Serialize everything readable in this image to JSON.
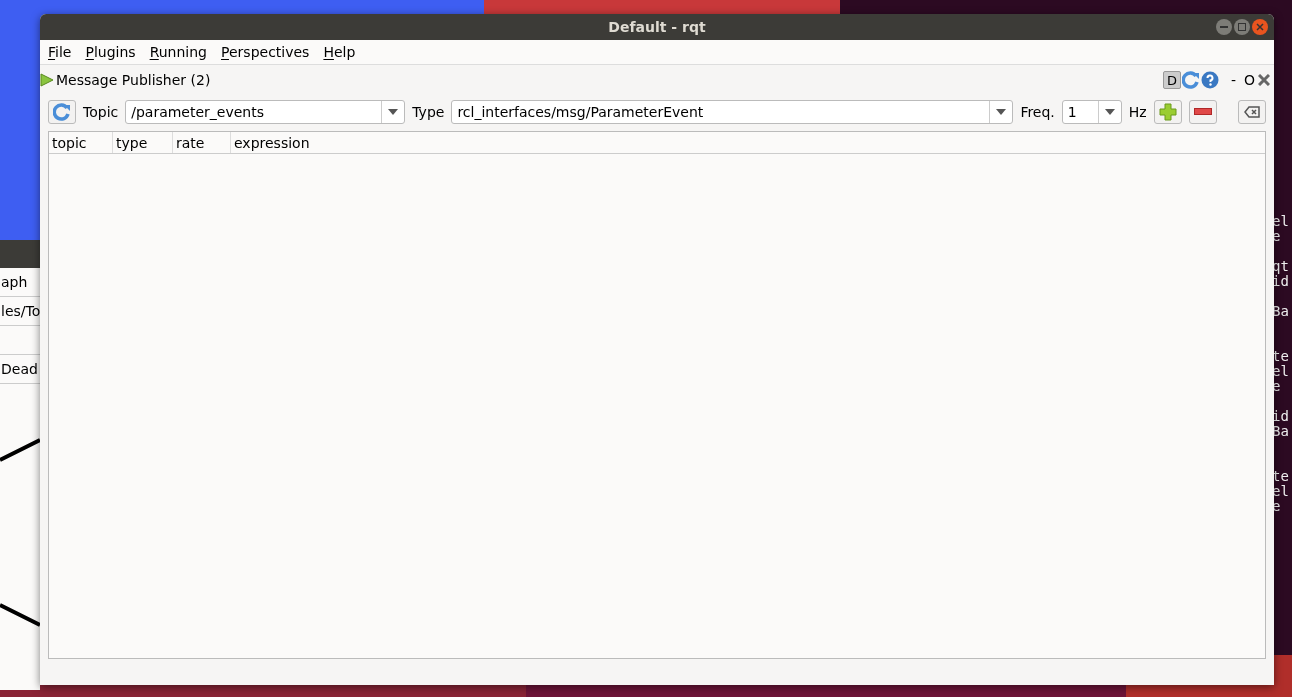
{
  "background_window": {
    "tab": "aph",
    "path": "les/To",
    "option": "Dead"
  },
  "terminal": {
    "lines": [
      "el",
      "e",
      "qt",
      "id",
      "Ba",
      "te",
      "el",
      "e",
      "id",
      "Ba",
      "te",
      "el",
      "e"
    ]
  },
  "window": {
    "title": "Default - rqt"
  },
  "menu": [
    "File",
    "Plugins",
    "Running",
    "Perspectives",
    "Help"
  ],
  "plugin": {
    "title": "Message Publisher (2)",
    "badge": "D",
    "minimize": "-",
    "float": "O"
  },
  "toolbar": {
    "topic_label": "Topic",
    "topic": "/parameter_events",
    "type_label": "Type",
    "type": "rcl_interfaces/msg/ParameterEvent",
    "freq_label": "Freq.",
    "freq": "1",
    "unit": "Hz"
  },
  "table": {
    "columns": [
      "topic",
      "type",
      "rate",
      "expression"
    ]
  }
}
